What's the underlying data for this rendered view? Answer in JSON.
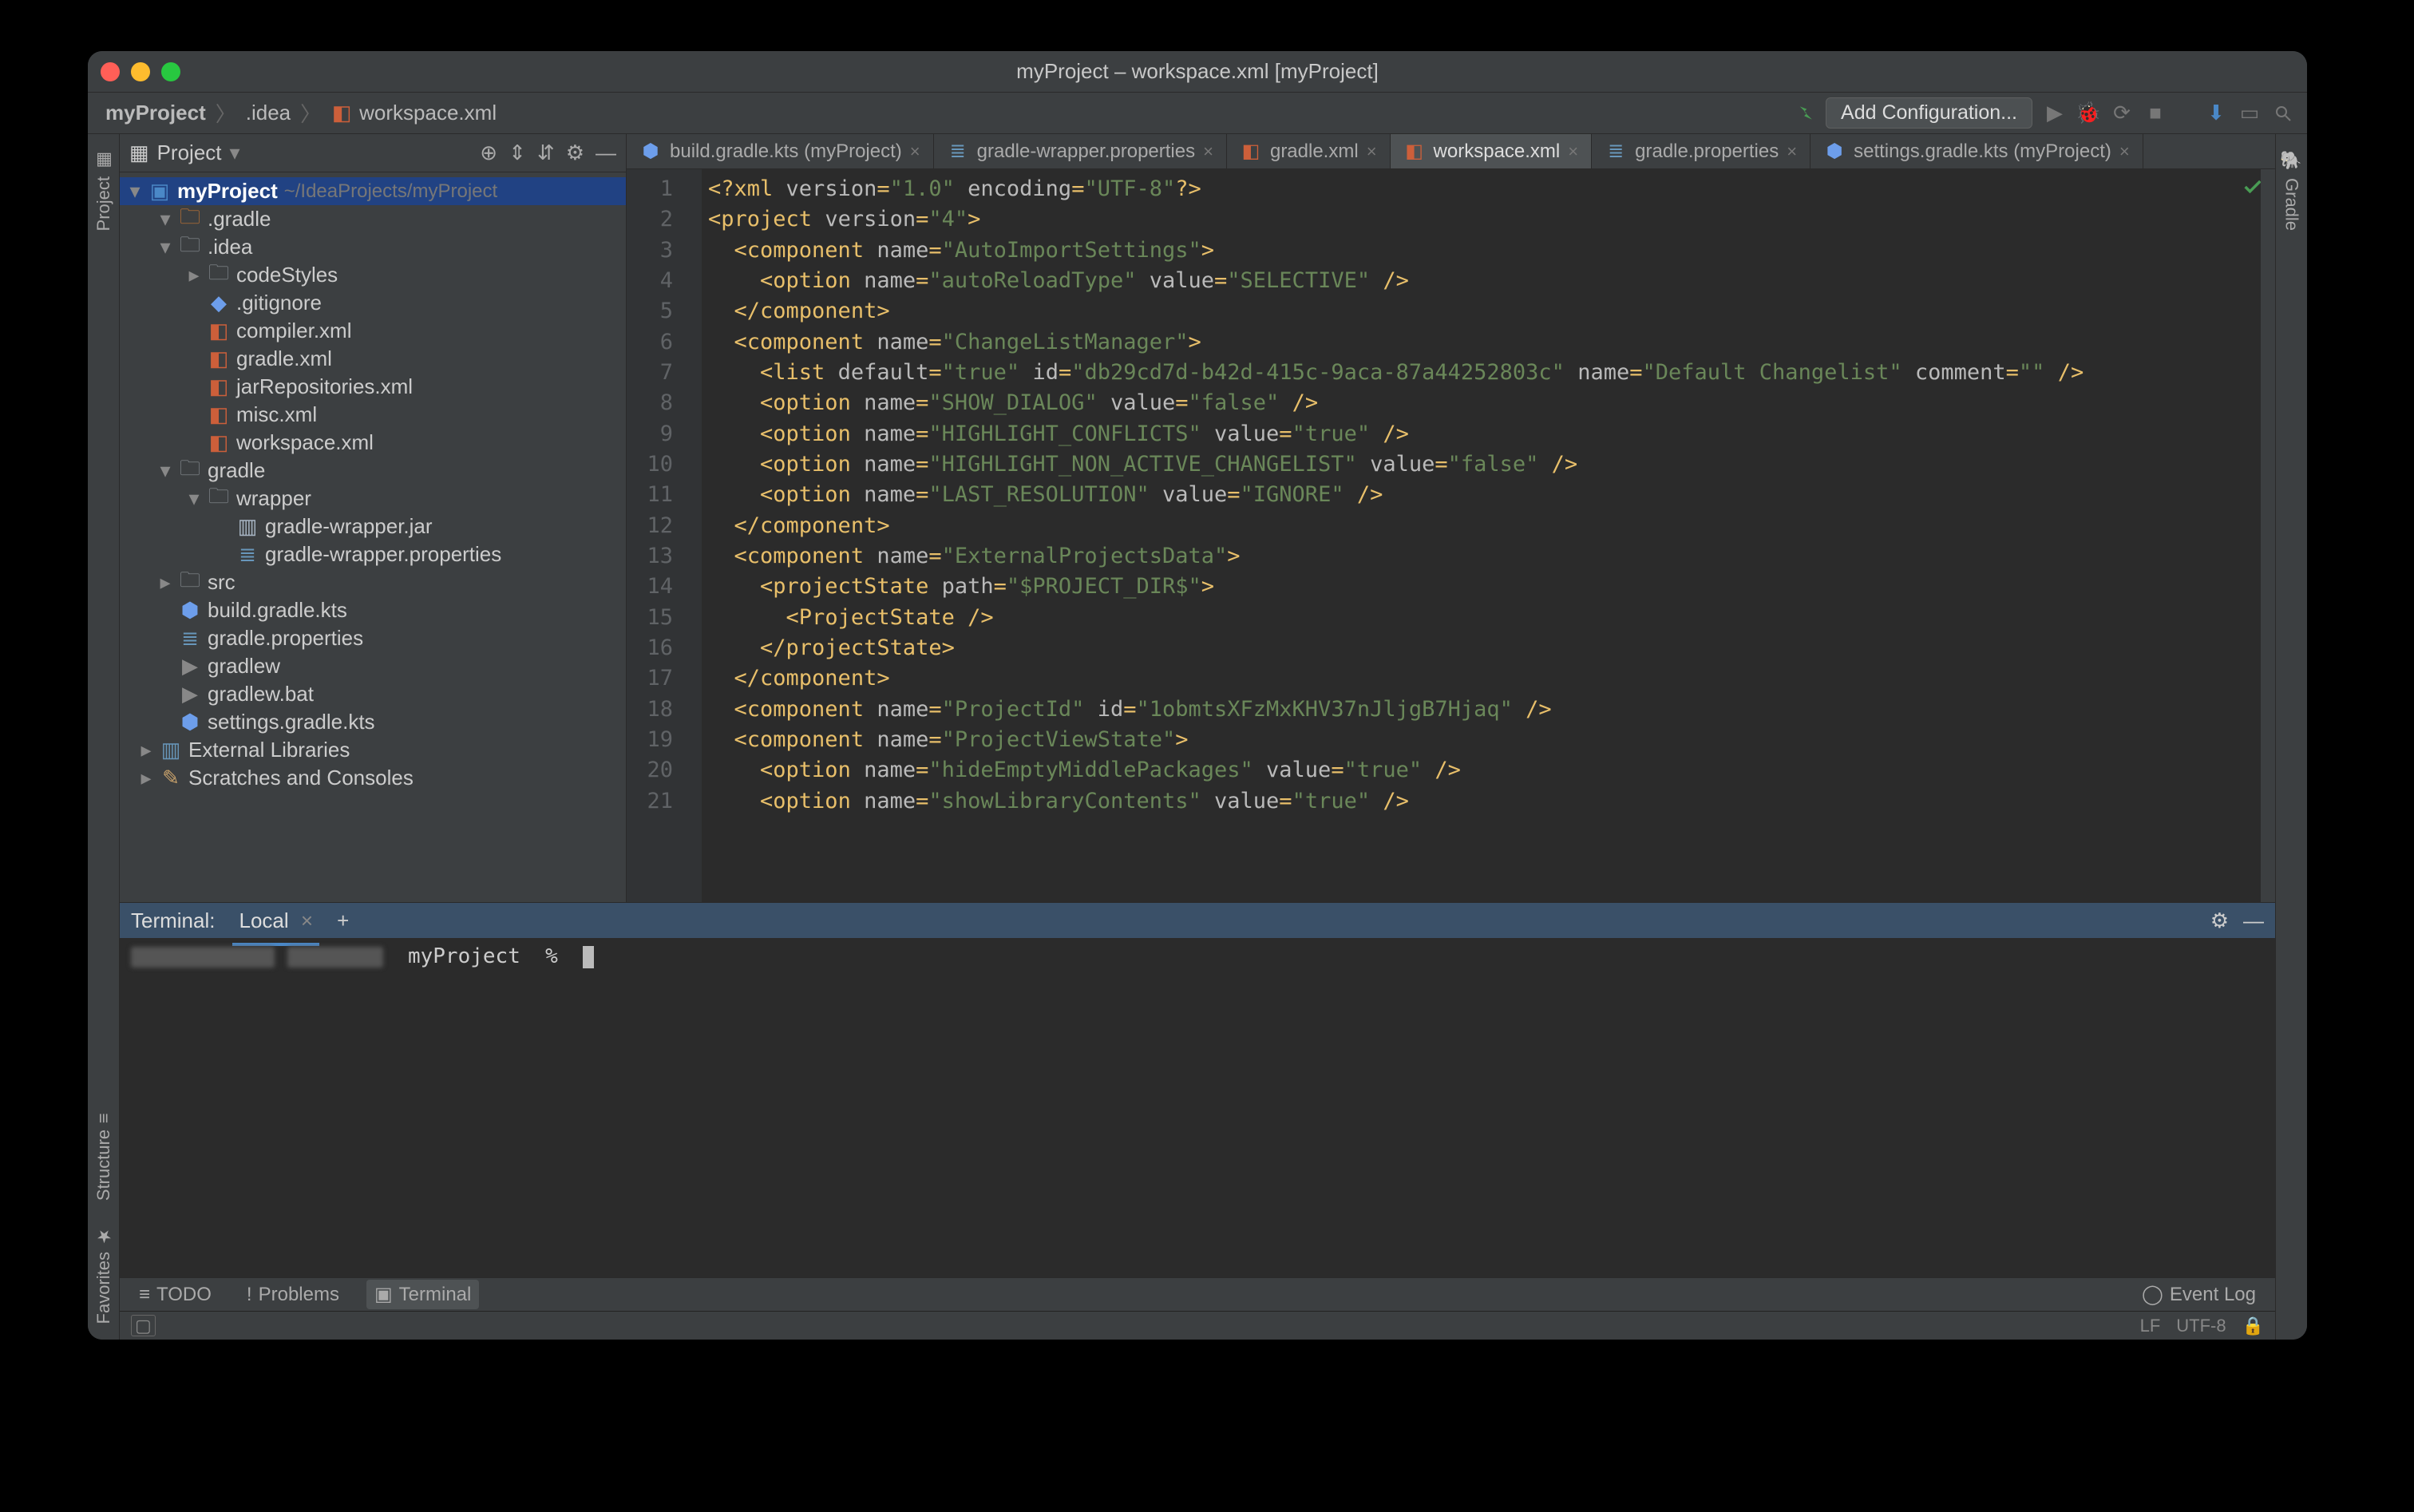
{
  "window": {
    "title": "myProject – workspace.xml [myProject]"
  },
  "breadcrumbs": [
    "myProject",
    ".idea",
    "workspace.xml"
  ],
  "navbar": {
    "add_config": "Add Configuration..."
  },
  "left_tools": [
    "Project"
  ],
  "left_tools_bottom": [
    "Structure",
    "Favorites"
  ],
  "right_tools": [
    "Gradle"
  ],
  "project_panel": {
    "title": "Project",
    "root_name": "myProject",
    "root_path": "~/IdeaProjects/myProject",
    "tree": [
      {
        "d": 0,
        "arrow": "▾",
        "icon": "folder-orange",
        "label": ".gradle"
      },
      {
        "d": 0,
        "arrow": "▾",
        "icon": "folder",
        "label": ".idea"
      },
      {
        "d": 1,
        "arrow": "▸",
        "icon": "folder",
        "label": "codeStyles"
      },
      {
        "d": 1,
        "arrow": "",
        "icon": "gitignore",
        "label": ".gitignore"
      },
      {
        "d": 1,
        "arrow": "",
        "icon": "xml",
        "label": "compiler.xml"
      },
      {
        "d": 1,
        "arrow": "",
        "icon": "xml",
        "label": "gradle.xml"
      },
      {
        "d": 1,
        "arrow": "",
        "icon": "xml",
        "label": "jarRepositories.xml"
      },
      {
        "d": 1,
        "arrow": "",
        "icon": "xml",
        "label": "misc.xml"
      },
      {
        "d": 1,
        "arrow": "",
        "icon": "xml",
        "label": "workspace.xml"
      },
      {
        "d": 0,
        "arrow": "▾",
        "icon": "folder",
        "label": "gradle"
      },
      {
        "d": 1,
        "arrow": "▾",
        "icon": "folder",
        "label": "wrapper"
      },
      {
        "d": 2,
        "arrow": "",
        "icon": "jar",
        "label": "gradle-wrapper.jar"
      },
      {
        "d": 2,
        "arrow": "",
        "icon": "props",
        "label": "gradle-wrapper.properties"
      },
      {
        "d": 0,
        "arrow": "▸",
        "icon": "folder",
        "label": "src"
      },
      {
        "d": 0,
        "arrow": "",
        "icon": "kts",
        "label": "build.gradle.kts"
      },
      {
        "d": 0,
        "arrow": "",
        "icon": "props",
        "label": "gradle.properties"
      },
      {
        "d": 0,
        "arrow": "",
        "icon": "sh",
        "label": "gradlew"
      },
      {
        "d": 0,
        "arrow": "",
        "icon": "sh",
        "label": "gradlew.bat"
      },
      {
        "d": 0,
        "arrow": "",
        "icon": "kts",
        "label": "settings.gradle.kts"
      }
    ],
    "ext": [
      {
        "arrow": "▸",
        "icon": "lib",
        "label": "External Libraries"
      },
      {
        "arrow": "▸",
        "icon": "scratch",
        "label": "Scratches and Consoles"
      }
    ]
  },
  "tabs": [
    {
      "label": "build.gradle.kts (myProject)",
      "icon": "kts"
    },
    {
      "label": "gradle-wrapper.properties",
      "icon": "props"
    },
    {
      "label": "gradle.xml",
      "icon": "xml"
    },
    {
      "label": "workspace.xml",
      "icon": "xml",
      "active": true
    },
    {
      "label": "gradle.properties",
      "icon": "props"
    },
    {
      "label": "settings.gradle.kts (myProject)",
      "icon": "kts"
    }
  ],
  "editor": {
    "first_line": 1,
    "lines": [
      [
        {
          "c": "tag",
          "t": "<?xml "
        },
        {
          "c": "attr",
          "t": "version"
        },
        {
          "c": "tag",
          "t": "="
        },
        {
          "c": "str",
          "t": "\"1.0\""
        },
        {
          "c": "attr",
          "t": " encoding"
        },
        {
          "c": "tag",
          "t": "="
        },
        {
          "c": "str",
          "t": "\"UTF-8\""
        },
        {
          "c": "tag",
          "t": "?>"
        }
      ],
      [
        {
          "c": "tag",
          "t": "<project "
        },
        {
          "c": "attr",
          "t": "version"
        },
        {
          "c": "tag",
          "t": "="
        },
        {
          "c": "str",
          "t": "\"4\""
        },
        {
          "c": "tag",
          "t": ">"
        }
      ],
      [
        {
          "c": "",
          "t": "  "
        },
        {
          "c": "tag",
          "t": "<component "
        },
        {
          "c": "attr",
          "t": "name"
        },
        {
          "c": "tag",
          "t": "="
        },
        {
          "c": "str",
          "t": "\"AutoImportSettings\""
        },
        {
          "c": "tag",
          "t": ">"
        }
      ],
      [
        {
          "c": "",
          "t": "    "
        },
        {
          "c": "tag",
          "t": "<option "
        },
        {
          "c": "attr",
          "t": "name"
        },
        {
          "c": "tag",
          "t": "="
        },
        {
          "c": "str",
          "t": "\"autoReloadType\""
        },
        {
          "c": "attr",
          "t": " value"
        },
        {
          "c": "tag",
          "t": "="
        },
        {
          "c": "str",
          "t": "\"SELECTIVE\""
        },
        {
          "c": "tag",
          "t": " />"
        }
      ],
      [
        {
          "c": "",
          "t": "  "
        },
        {
          "c": "tag",
          "t": "</component>"
        }
      ],
      [
        {
          "c": "",
          "t": "  "
        },
        {
          "c": "tag",
          "t": "<component "
        },
        {
          "c": "attr",
          "t": "name"
        },
        {
          "c": "tag",
          "t": "="
        },
        {
          "c": "str",
          "t": "\"ChangeListManager\""
        },
        {
          "c": "tag",
          "t": ">"
        }
      ],
      [
        {
          "c": "",
          "t": "    "
        },
        {
          "c": "tag",
          "t": "<list "
        },
        {
          "c": "attr",
          "t": "default"
        },
        {
          "c": "tag",
          "t": "="
        },
        {
          "c": "str",
          "t": "\"true\""
        },
        {
          "c": "attr",
          "t": " id"
        },
        {
          "c": "tag",
          "t": "="
        },
        {
          "c": "str",
          "t": "\"db29cd7d-b42d-415c-9aca-87a44252803c\""
        },
        {
          "c": "attr",
          "t": " name"
        },
        {
          "c": "tag",
          "t": "="
        },
        {
          "c": "str",
          "t": "\"Default Changelist\""
        },
        {
          "c": "attr",
          "t": " comment"
        },
        {
          "c": "tag",
          "t": "="
        },
        {
          "c": "str",
          "t": "\"\""
        },
        {
          "c": "tag",
          "t": " />"
        }
      ],
      [
        {
          "c": "",
          "t": "    "
        },
        {
          "c": "tag",
          "t": "<option "
        },
        {
          "c": "attr",
          "t": "name"
        },
        {
          "c": "tag",
          "t": "="
        },
        {
          "c": "str",
          "t": "\"SHOW_DIALOG\""
        },
        {
          "c": "attr",
          "t": " value"
        },
        {
          "c": "tag",
          "t": "="
        },
        {
          "c": "str",
          "t": "\"false\""
        },
        {
          "c": "tag",
          "t": " />"
        }
      ],
      [
        {
          "c": "",
          "t": "    "
        },
        {
          "c": "tag",
          "t": "<option "
        },
        {
          "c": "attr",
          "t": "name"
        },
        {
          "c": "tag",
          "t": "="
        },
        {
          "c": "str",
          "t": "\"HIGHLIGHT_CONFLICTS\""
        },
        {
          "c": "attr",
          "t": " value"
        },
        {
          "c": "tag",
          "t": "="
        },
        {
          "c": "str",
          "t": "\"true\""
        },
        {
          "c": "tag",
          "t": " />"
        }
      ],
      [
        {
          "c": "",
          "t": "    "
        },
        {
          "c": "tag",
          "t": "<option "
        },
        {
          "c": "attr",
          "t": "name"
        },
        {
          "c": "tag",
          "t": "="
        },
        {
          "c": "str",
          "t": "\"HIGHLIGHT_NON_ACTIVE_CHANGELIST\""
        },
        {
          "c": "attr",
          "t": " value"
        },
        {
          "c": "tag",
          "t": "="
        },
        {
          "c": "str",
          "t": "\"false\""
        },
        {
          "c": "tag",
          "t": " />"
        }
      ],
      [
        {
          "c": "",
          "t": "    "
        },
        {
          "c": "tag",
          "t": "<option "
        },
        {
          "c": "attr",
          "t": "name"
        },
        {
          "c": "tag",
          "t": "="
        },
        {
          "c": "str",
          "t": "\"LAST_RESOLUTION\""
        },
        {
          "c": "attr",
          "t": " value"
        },
        {
          "c": "tag",
          "t": "="
        },
        {
          "c": "str",
          "t": "\"IGNORE\""
        },
        {
          "c": "tag",
          "t": " />"
        }
      ],
      [
        {
          "c": "",
          "t": "  "
        },
        {
          "c": "tag",
          "t": "</component>"
        }
      ],
      [
        {
          "c": "",
          "t": "  "
        },
        {
          "c": "tag",
          "t": "<component "
        },
        {
          "c": "attr",
          "t": "name"
        },
        {
          "c": "tag",
          "t": "="
        },
        {
          "c": "str",
          "t": "\"ExternalProjectsData\""
        },
        {
          "c": "tag",
          "t": ">"
        }
      ],
      [
        {
          "c": "",
          "t": "    "
        },
        {
          "c": "tag",
          "t": "<projectState "
        },
        {
          "c": "attr",
          "t": "path"
        },
        {
          "c": "tag",
          "t": "="
        },
        {
          "c": "str",
          "t": "\"$PROJECT_DIR$\""
        },
        {
          "c": "tag",
          "t": ">"
        }
      ],
      [
        {
          "c": "",
          "t": "      "
        },
        {
          "c": "tag",
          "t": "<ProjectState />"
        }
      ],
      [
        {
          "c": "",
          "t": "    "
        },
        {
          "c": "tag",
          "t": "</projectState>"
        }
      ],
      [
        {
          "c": "",
          "t": "  "
        },
        {
          "c": "tag",
          "t": "</component>"
        }
      ],
      [
        {
          "c": "",
          "t": "  "
        },
        {
          "c": "tag",
          "t": "<component "
        },
        {
          "c": "attr",
          "t": "name"
        },
        {
          "c": "tag",
          "t": "="
        },
        {
          "c": "str",
          "t": "\"ProjectId\""
        },
        {
          "c": "attr",
          "t": " id"
        },
        {
          "c": "tag",
          "t": "="
        },
        {
          "c": "str",
          "t": "\"1obmtsXFzMxKHV37nJljgB7Hjaq\""
        },
        {
          "c": "tag",
          "t": " />"
        }
      ],
      [
        {
          "c": "",
          "t": "  "
        },
        {
          "c": "tag",
          "t": "<component "
        },
        {
          "c": "attr",
          "t": "name"
        },
        {
          "c": "tag",
          "t": "="
        },
        {
          "c": "str",
          "t": "\"ProjectViewState\""
        },
        {
          "c": "tag",
          "t": ">"
        }
      ],
      [
        {
          "c": "",
          "t": "    "
        },
        {
          "c": "tag",
          "t": "<option "
        },
        {
          "c": "attr",
          "t": "name"
        },
        {
          "c": "tag",
          "t": "="
        },
        {
          "c": "str",
          "t": "\"hideEmptyMiddlePackages\""
        },
        {
          "c": "attr",
          "t": " value"
        },
        {
          "c": "tag",
          "t": "="
        },
        {
          "c": "str",
          "t": "\"true\""
        },
        {
          "c": "tag",
          "t": " />"
        }
      ],
      [
        {
          "c": "",
          "t": "    "
        },
        {
          "c": "tag",
          "t": "<option "
        },
        {
          "c": "attr",
          "t": "name"
        },
        {
          "c": "tag",
          "t": "="
        },
        {
          "c": "str",
          "t": "\"showLibraryContents\""
        },
        {
          "c": "attr",
          "t": " value"
        },
        {
          "c": "tag",
          "t": "="
        },
        {
          "c": "str",
          "t": "\"true\""
        },
        {
          "c": "tag",
          "t": " />"
        }
      ]
    ]
  },
  "terminal": {
    "title": "Terminal:",
    "tab": "Local",
    "prompt_project": "myProject",
    "prompt_char": "%"
  },
  "bottombar": {
    "items": [
      {
        "label": "TODO",
        "icon": "≡"
      },
      {
        "label": "Problems",
        "icon": "!"
      },
      {
        "label": "Terminal",
        "icon": "▣",
        "active": true
      }
    ],
    "event_log": "Event Log"
  },
  "statusbar": {
    "line_sep": "LF",
    "encoding": "UTF-8"
  }
}
